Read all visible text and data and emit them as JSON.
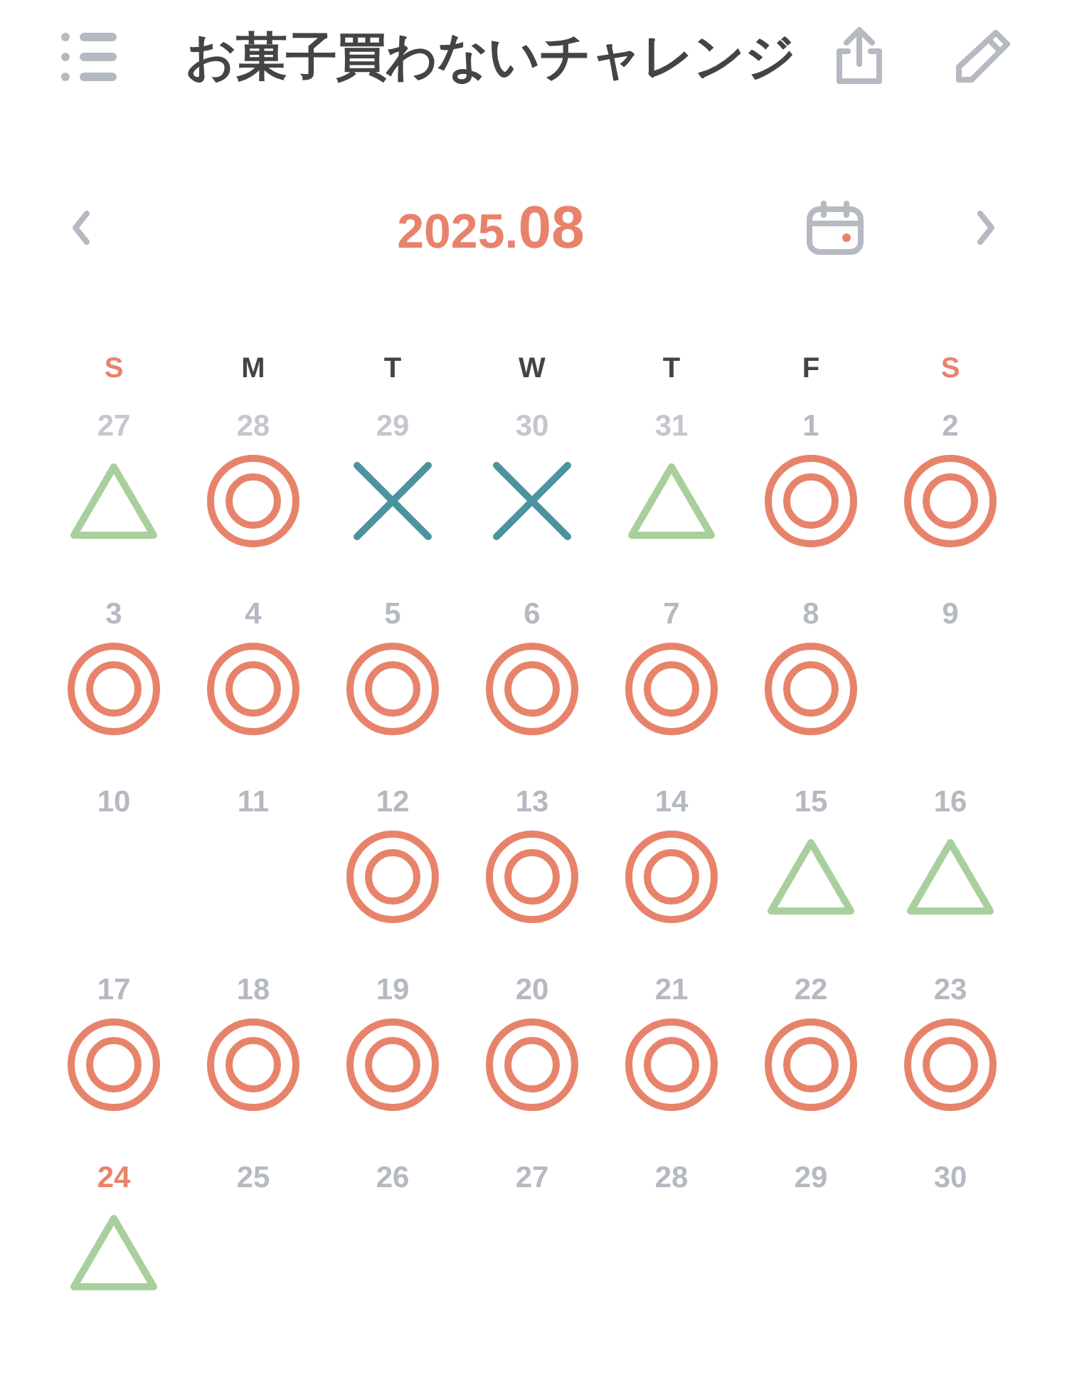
{
  "title": "お菓子買わないチャレンジ",
  "month": {
    "year": "2025.",
    "month": "08"
  },
  "weekdays": [
    {
      "label": "S",
      "weekend": true
    },
    {
      "label": "M",
      "weekend": false
    },
    {
      "label": "T",
      "weekend": false
    },
    {
      "label": "W",
      "weekend": false
    },
    {
      "label": "T",
      "weekend": false
    },
    {
      "label": "F",
      "weekend": false
    },
    {
      "label": "S",
      "weekend": true
    }
  ],
  "days": [
    {
      "day": "27",
      "other_month": true,
      "today": false,
      "kind": "triangle"
    },
    {
      "day": "28",
      "other_month": true,
      "today": false,
      "kind": "double-circle"
    },
    {
      "day": "29",
      "other_month": true,
      "today": false,
      "kind": "cross"
    },
    {
      "day": "30",
      "other_month": true,
      "today": false,
      "kind": "cross"
    },
    {
      "day": "31",
      "other_month": true,
      "today": false,
      "kind": "triangle"
    },
    {
      "day": "1",
      "other_month": false,
      "today": false,
      "kind": "double-circle"
    },
    {
      "day": "2",
      "other_month": false,
      "today": false,
      "kind": "double-circle"
    },
    {
      "day": "3",
      "other_month": false,
      "today": false,
      "kind": "double-circle"
    },
    {
      "day": "4",
      "other_month": false,
      "today": false,
      "kind": "double-circle"
    },
    {
      "day": "5",
      "other_month": false,
      "today": false,
      "kind": "double-circle"
    },
    {
      "day": "6",
      "other_month": false,
      "today": false,
      "kind": "double-circle"
    },
    {
      "day": "7",
      "other_month": false,
      "today": false,
      "kind": "double-circle"
    },
    {
      "day": "8",
      "other_month": false,
      "today": false,
      "kind": "double-circle"
    },
    {
      "day": "9",
      "other_month": false,
      "today": false
    },
    {
      "day": "10",
      "other_month": false,
      "today": false
    },
    {
      "day": "11",
      "other_month": false,
      "today": false
    },
    {
      "day": "12",
      "other_month": false,
      "today": false,
      "kind": "double-circle"
    },
    {
      "day": "13",
      "other_month": false,
      "today": false,
      "kind": "double-circle"
    },
    {
      "day": "14",
      "other_month": false,
      "today": false,
      "kind": "double-circle"
    },
    {
      "day": "15",
      "other_month": false,
      "today": false,
      "kind": "triangle"
    },
    {
      "day": "16",
      "other_month": false,
      "today": false,
      "kind": "triangle"
    },
    {
      "day": "17",
      "other_month": false,
      "today": false,
      "kind": "double-circle"
    },
    {
      "day": "18",
      "other_month": false,
      "today": false,
      "kind": "double-circle"
    },
    {
      "day": "19",
      "other_month": false,
      "today": false,
      "kind": "double-circle"
    },
    {
      "day": "20",
      "other_month": false,
      "today": false,
      "kind": "double-circle"
    },
    {
      "day": "21",
      "other_month": false,
      "today": false,
      "kind": "double-circle"
    },
    {
      "day": "22",
      "other_month": false,
      "today": false,
      "kind": "double-circle"
    },
    {
      "day": "23",
      "other_month": false,
      "today": false,
      "kind": "double-circle"
    },
    {
      "day": "24",
      "other_month": false,
      "today": true,
      "kind": "triangle"
    },
    {
      "day": "25",
      "other_month": false,
      "today": false
    },
    {
      "day": "26",
      "other_month": false,
      "today": false
    },
    {
      "day": "27",
      "other_month": false,
      "today": false
    },
    {
      "day": "28",
      "other_month": false,
      "today": false
    },
    {
      "day": "29",
      "other_month": false,
      "today": false
    },
    {
      "day": "30",
      "other_month": false,
      "today": false
    }
  ]
}
